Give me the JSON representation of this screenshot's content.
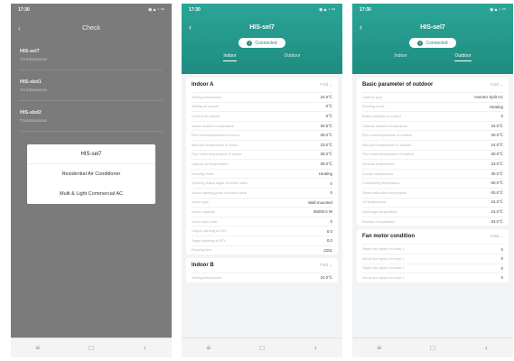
{
  "status": {
    "time": "17:30",
    "icons": "◉▲◔ ⁹⁶"
  },
  "phone1": {
    "title": "Check",
    "devices": [
      {
        "name": "HIS-sel7",
        "sub": "7cc43xxxxxxxx"
      },
      {
        "name": "HIS-sbd1",
        "sub": "7cc43xxxxxxxx"
      },
      {
        "name": "HIS-sbd2",
        "sub": "7cc43xxxxxxxx"
      }
    ],
    "dialog": {
      "title": "HIS-sel7",
      "options": [
        "Residential Air Conditioner",
        "Multi & Light Commercial AC"
      ]
    }
  },
  "phone2": {
    "title": "HIS-sel7",
    "connection": "Connected",
    "tabs": [
      "Indoor",
      "Outdoor"
    ],
    "cards": [
      {
        "title": "Indoor A",
        "fold": "Fold ⌄",
        "rows": [
          {
            "k": "Setting temperature",
            "v": "24.0℃"
          },
          {
            "k": "Setting air volume",
            "v": "0℃"
          },
          {
            "k": "Current air volume",
            "v": "0℃"
          },
          {
            "k": "Indoor ambient temperature",
            "v": "30.5℃"
          },
          {
            "k": "Pipe inlet temperature of indoor",
            "v": "30.0℃"
          },
          {
            "k": "Mid-pipe temperature of indoor",
            "v": "23.0℃"
          },
          {
            "k": "Pipe outlet temperature of indoor",
            "v": "30.0℃"
          },
          {
            "k": "Outdoor air temperature",
            "v": "30.0℃"
          },
          {
            "k": "Running mode",
            "v": "Heating"
          },
          {
            "k": "Opening output angle of indoor valve",
            "v": "0"
          },
          {
            "k": "Actual opening pulse of indoor valve",
            "v": "0"
          },
          {
            "k": "Indoor type",
            "v": "Wall-mounted"
          },
          {
            "k": "Indoor capacity",
            "v": "35000.0 W"
          },
          {
            "k": "Indoor fault code",
            "v": "0"
          },
          {
            "k": "Output opening of EEV",
            "v": "0.0"
          },
          {
            "k": "Target opening of EEV",
            "v": "0.0"
          },
          {
            "k": "Running time",
            "v": "2201"
          }
        ]
      },
      {
        "title": "Indoor B",
        "fold": "Fold ⌄",
        "rows": [
          {
            "k": "Setting temperature",
            "v": "24.0℃"
          }
        ]
      }
    ]
  },
  "phone3": {
    "title": "HIS-sel7",
    "connection": "Connected",
    "tabs": [
      "Indoor",
      "Outdoor"
    ],
    "cards": [
      {
        "title": "Basic parameter of outdoor",
        "fold": "Fold ⌄",
        "rows": [
          {
            "k": "Outdoor type",
            "v": "Inverter Split AC"
          },
          {
            "k": "Running mode",
            "v": "Heating"
          },
          {
            "k": "Rated capacity of outdoor",
            "v": "0"
          },
          {
            "k": "Outdoor ambient temperature",
            "v": "34.0℃"
          },
          {
            "k": "Pipe inlet temperature of outdoor",
            "v": "30.0℃"
          },
          {
            "k": "Mid-pipe temperature of outdoor",
            "v": "24.0℃"
          },
          {
            "k": "Pipe outlet temperature of outdoor",
            "v": "30.0℃"
          },
          {
            "k": "Exhaust temperature",
            "v": "33.0℃"
          },
          {
            "k": "Suction temperature",
            "v": "30.0℃"
          },
          {
            "k": "Condensing temperature",
            "v": "-30.0℃"
          },
          {
            "k": "Tower saturation temperature",
            "v": "-30.0℃"
          },
          {
            "k": "Oil temperature",
            "v": "24.0℃"
          },
          {
            "k": "Discharge temperature",
            "v": "24.0℃"
          },
          {
            "k": "Radiator temperature",
            "v": "34.0℃"
          }
        ]
      },
      {
        "title": "Fan motor condition",
        "fold": "Fold ⌄",
        "rows": [
          {
            "k": "Target fan speed of motor 1",
            "v": "0"
          },
          {
            "k": "Actual fan speed of motor 1",
            "v": "0"
          },
          {
            "k": "Target fan speed of motor 2",
            "v": "0"
          },
          {
            "k": "Actual fan speed of motor 2",
            "v": "0"
          }
        ]
      }
    ]
  },
  "nav": [
    "≡",
    "□",
    "‹"
  ]
}
